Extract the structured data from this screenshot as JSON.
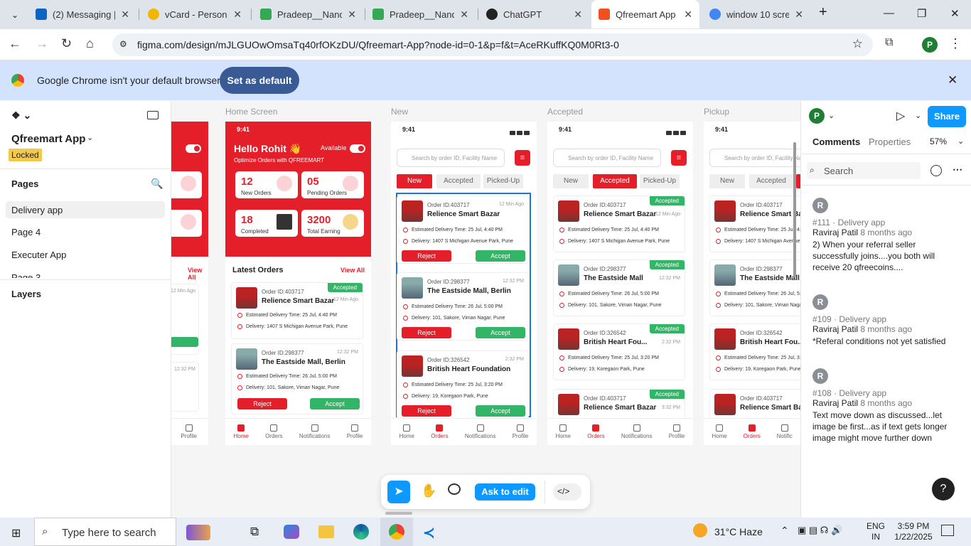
{
  "browser": {
    "tabs": [
      {
        "label": "(2) Messaging | L",
        "color": "#0a66c2"
      },
      {
        "label": "vCard - Personal",
        "color": "#f2b705"
      },
      {
        "label": "Pradeep__Nanda",
        "color": "#34a853"
      },
      {
        "label": "Pradeep__Nanda",
        "color": "#34a853"
      },
      {
        "label": "ChatGPT",
        "color": "#222222"
      },
      {
        "label": "Qfreemart App - ",
        "color": "#f24e1e"
      },
      {
        "label": "window 10 scree",
        "color": "#4285f4"
      }
    ],
    "url": "figma.com/design/mJLGUOwOmsaTq40rfOKzDU/Qfreemart-App?node-id=0-1&p=f&t=AceRKuffKQ0M0Rt3-0",
    "profile_initial": "P"
  },
  "infobar": {
    "message": "Google Chrome isn't your default browser",
    "button": "Set as default"
  },
  "figma": {
    "file_name": "Qfreemart App",
    "locked": "Locked",
    "pages_label": "Pages",
    "pages": [
      "Delivery app",
      "Page 4",
      "Executer App",
      "Page 3"
    ],
    "layers_label": "Layers",
    "share": "Share",
    "tabs": {
      "comments": "Comments",
      "properties": "Properties"
    },
    "zoom": "57%",
    "search_placeholder": "Search",
    "user_initial": "P",
    "ask_to_edit": "Ask to edit"
  },
  "frames": {
    "home": "Home Screen",
    "new": "New",
    "accepted": "Accepted",
    "pickup": "Pickup"
  },
  "phone": {
    "time": "9:41",
    "search_placeholder": "Search by order ID, Facility Name",
    "filters": [
      "New",
      "Accepted",
      "Picked-Up"
    ],
    "greeting": "Hello Rohit 👋",
    "sub": "Optimize Orders with QFREEMART",
    "available": "Available",
    "stats": [
      {
        "n": "12",
        "l": "New Orders"
      },
      {
        "n": "05",
        "l": "Pending Orders"
      },
      {
        "n": "18",
        "l": "Completed"
      },
      {
        "n": "3200",
        "l": "Total Earning"
      }
    ],
    "latest": "Latest Orders",
    "view_all": "View All",
    "reject": "Reject",
    "accept": "Accept",
    "accepted_badge": "Accepted",
    "nav": [
      "Home",
      "Orders",
      "Notifications",
      "Profile"
    ],
    "orders": [
      {
        "id": "Order ID:403717",
        "name": "Relience Smart Bazar",
        "time": "12 Min Ago",
        "est": "Estimated Delivery Time: 25 Jul, 4:40 PM",
        "addr": "Delivery: 1407 S Michigan Avenue Park, Pune"
      },
      {
        "id": "Order ID:298377",
        "name": "The Eastside Mall, Berlin",
        "time": "12:32 PM",
        "est": "Estimated Delivery Time: 26 Jul, 5:00 PM",
        "addr": "Delivery: 101, Sakore, Viman Nagar, Pune"
      },
      {
        "id": "Order ID:326542",
        "name": "British Heart Foundation",
        "time": "2:32 PM",
        "est": "Estimated Delivery Time: 25 Jul, 3:20 PM",
        "addr": "Delivery: 19, Koregaon Park, Pune"
      }
    ],
    "accepted_names": [
      "Relience Smart Bazar",
      "The Eastside Mall",
      "British Heart Fou...",
      "Relience Smart Bazar"
    ],
    "accepted_times": [
      "12 Min Ago",
      "12:32 PM",
      "2:32 PM",
      "3:32 PM"
    ],
    "accepted_ids": [
      "Order ID:403717",
      "Order ID:298377",
      "Order ID:326542",
      "Order ID:403717"
    ]
  },
  "comments": [
    {
      "meta": "#111 · Delivery app",
      "author": "Raviraj Patil",
      "ago": "8 months ago",
      "text": "2) When your referral seller successfully joins....you both will receive 20 qfreecoins...."
    },
    {
      "meta": "#109 · Delivery app",
      "author": "Raviraj Patil",
      "ago": "8 months ago",
      "text": "*Referal conditions not yet satisfied"
    },
    {
      "meta": "#108 · Delivery app",
      "author": "Raviraj Patil",
      "ago": "8 months ago",
      "text": "Text move down as discussed...let image be first...as if text gets longer image might move further down"
    }
  ],
  "taskbar": {
    "search": "Type here to search",
    "weather": "31°C  Haze",
    "lang1": "ENG",
    "lang2": "IN",
    "time": "3:59 PM",
    "date": "1/22/2025"
  }
}
